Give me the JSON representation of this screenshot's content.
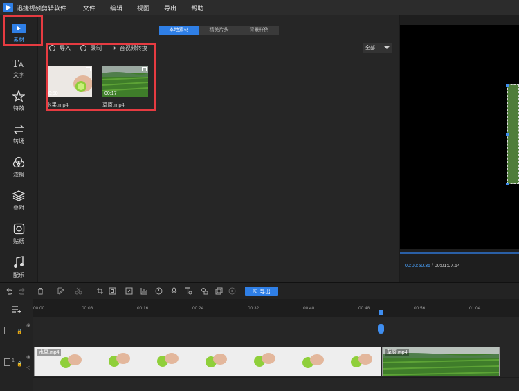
{
  "app": {
    "title": "迅捷视频剪辑软件"
  },
  "menu": [
    "文件",
    "编辑",
    "视图",
    "导出",
    "帮助"
  ],
  "sidebar": {
    "items": [
      {
        "label": "素材",
        "icon": "media-play-icon",
        "active": true
      },
      {
        "label": "文字",
        "icon": "text-icon"
      },
      {
        "label": "特效",
        "icon": "effects-star-icon"
      },
      {
        "label": "转场",
        "icon": "transition-icon"
      },
      {
        "label": "滤镜",
        "icon": "filter-circles-icon"
      },
      {
        "label": "叠附",
        "icon": "overlay-layers-icon"
      },
      {
        "label": "贴纸",
        "icon": "sticker-icon"
      },
      {
        "label": "配乐",
        "icon": "music-note-icon"
      }
    ]
  },
  "media": {
    "tabs": [
      "本地素材",
      "精美片头",
      "背景样例"
    ],
    "toolbar": {
      "import": "导入",
      "record": "录制",
      "screen_record": "音视频转换"
    },
    "filter": "全部",
    "items": [
      {
        "name": "水果.mp4",
        "duration": "0:50"
      },
      {
        "name": "草原.mp4",
        "duration": "00:17"
      }
    ]
  },
  "preview": {
    "current_time": "00:00:50.35",
    "separator": " / ",
    "total_time": "00:01:07.54"
  },
  "toolbar": {
    "export_label": "导出"
  },
  "timeline": {
    "ruler": [
      "00:00",
      "00:08",
      "00:16",
      "00:24",
      "00:32",
      "00:40",
      "00:48",
      "00:56",
      "01:04"
    ],
    "clips": [
      {
        "name": "水果.mp4"
      },
      {
        "name": "草原.mp4"
      }
    ]
  },
  "colors": {
    "accent": "#2f7fe6",
    "highlight": "#e63b41",
    "background": "#1b1b1b"
  }
}
